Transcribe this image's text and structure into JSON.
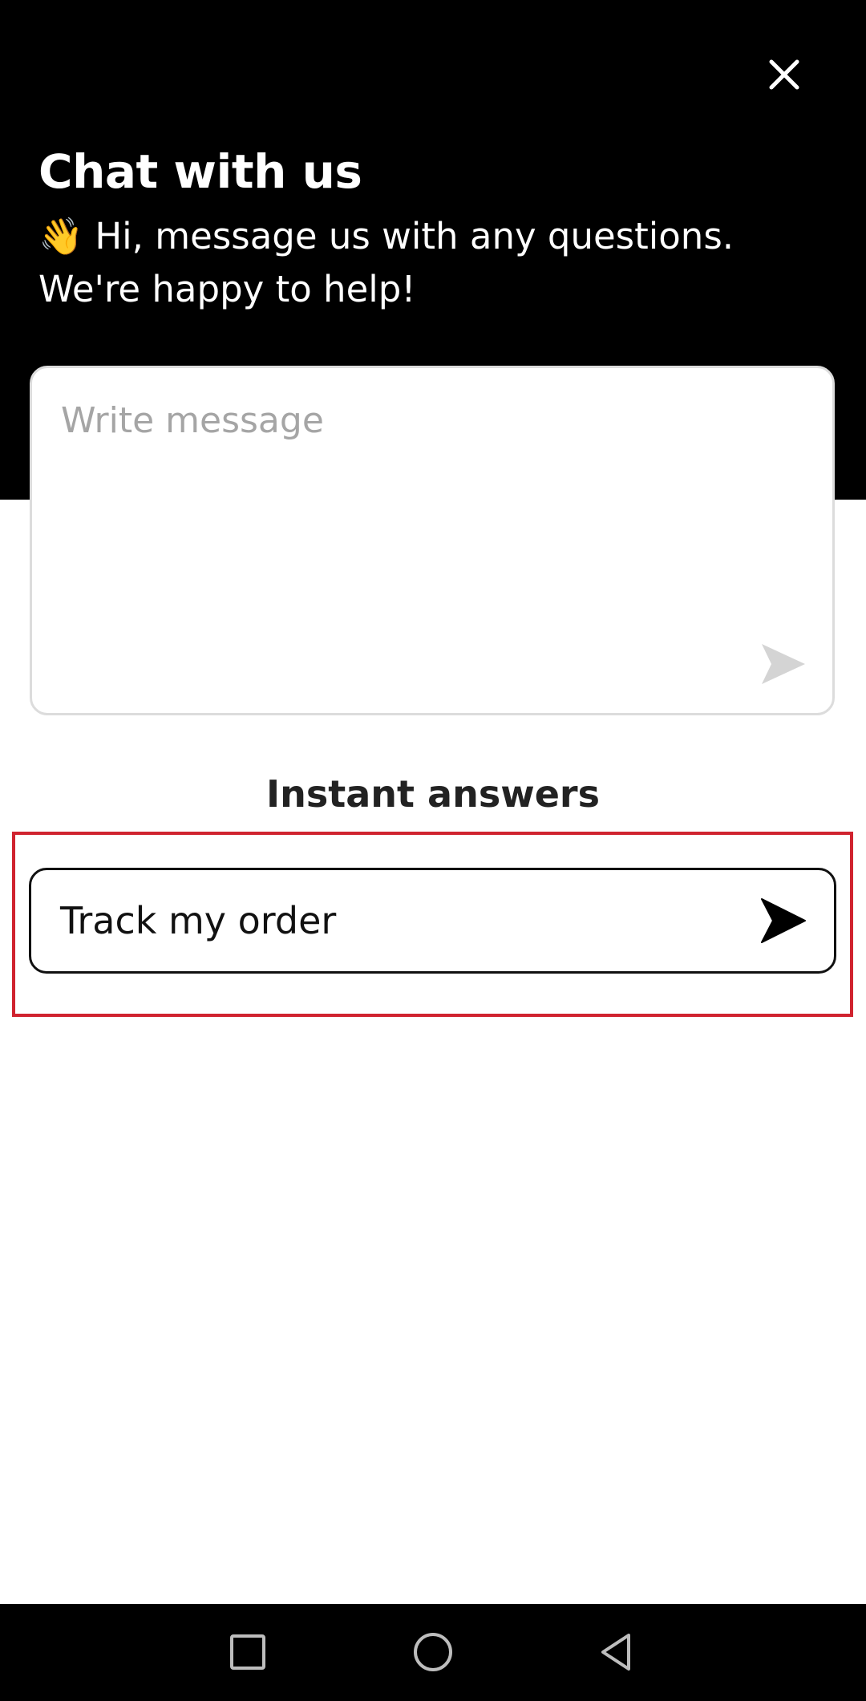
{
  "header": {
    "title": "Chat with us",
    "wave_emoji": "👋",
    "subtitle": "Hi, message us with any questions. We're happy to help!",
    "close_icon": "close-icon"
  },
  "composer": {
    "value": "",
    "placeholder": "Write message",
    "send_icon": "send-icon"
  },
  "instant_answers": {
    "title": "Instant answers",
    "items": [
      {
        "label": "Track my order",
        "icon": "send-icon"
      }
    ]
  },
  "navbar": {
    "items": [
      "recents-icon",
      "home-icon",
      "back-icon"
    ]
  },
  "colors": {
    "header_bg": "#000000",
    "highlight": "#d0232f",
    "placeholder": "#a5a5a5",
    "border": "#dcdcdc"
  }
}
